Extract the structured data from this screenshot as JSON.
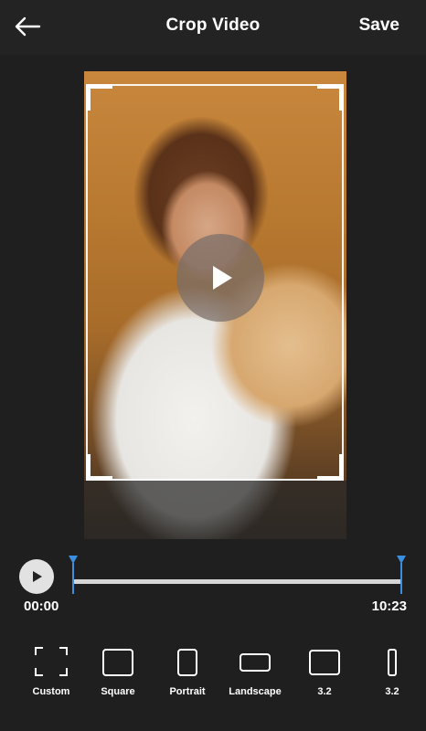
{
  "header": {
    "title": "Crop Video",
    "save_label": "Save"
  },
  "player": {
    "time_start": "00:00",
    "time_end": "10:23"
  },
  "ratios": [
    {
      "label": "Custom"
    },
    {
      "label": "Square"
    },
    {
      "label": "Portrait"
    },
    {
      "label": "Landscape"
    },
    {
      "label": "3.2"
    },
    {
      "label": "3.2"
    }
  ],
  "colors": {
    "background": "#1f1f1f",
    "header": "#232323",
    "accent": "#3a8fe0"
  },
  "icons": {
    "back": "arrow-left-icon",
    "play": "play-icon"
  }
}
